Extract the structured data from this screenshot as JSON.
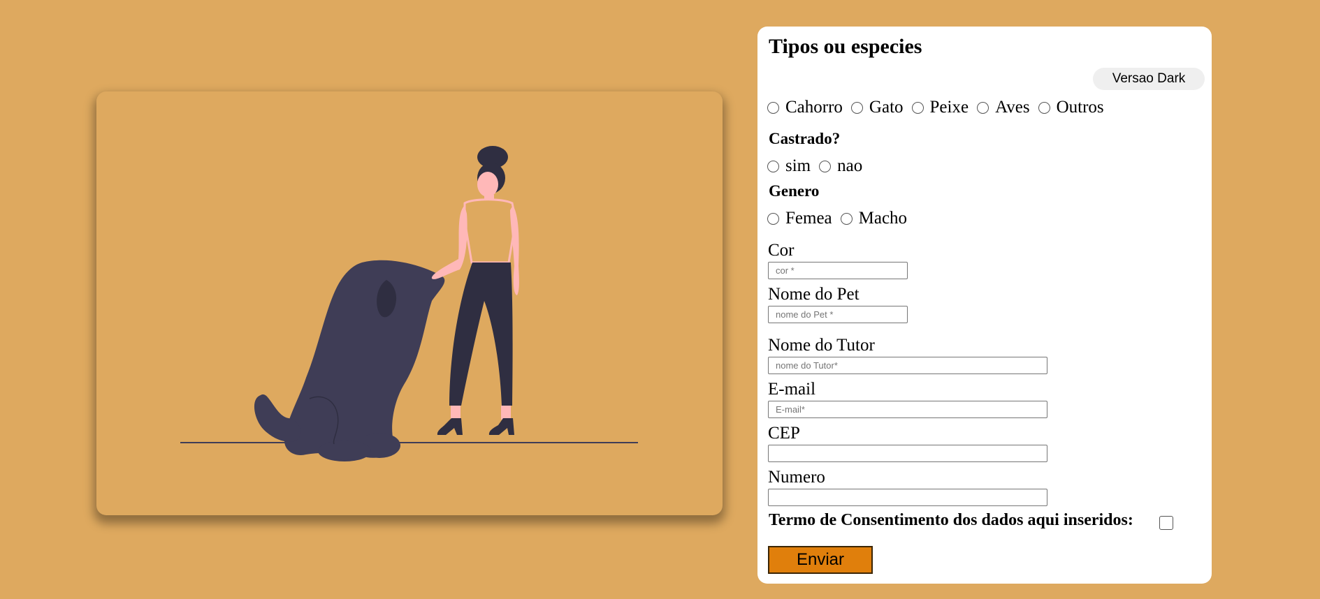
{
  "illustration": {
    "icon": "woman-with-dog-illustration",
    "colors": {
      "dark": "#3f3d56",
      "pants": "#2f2e41",
      "skin": "#ffb8b8",
      "card": "#dea95f"
    }
  },
  "form": {
    "title": "Tipos ou especies",
    "dark_mode_button": "Versao Dark",
    "species": [
      "Cahorro",
      "Gato",
      "Peixe",
      "Aves",
      "Outros"
    ],
    "neutered": {
      "label": "Castrado?",
      "options": [
        "sim",
        "nao"
      ]
    },
    "gender": {
      "label": "Genero",
      "options": [
        "Femea",
        "Macho"
      ]
    },
    "fields": {
      "color": {
        "label": "Cor",
        "placeholder": "cor *",
        "value": ""
      },
      "pet_name": {
        "label": "Nome do Pet",
        "placeholder": "nome do Pet *",
        "value": ""
      },
      "tutor_name": {
        "label": "Nome do Tutor",
        "placeholder": "nome do Tutor*",
        "value": ""
      },
      "email": {
        "label": "E-mail",
        "placeholder": "E-mail*",
        "value": ""
      },
      "cep": {
        "label": "CEP",
        "placeholder": "",
        "value": ""
      },
      "number": {
        "label": "Numero",
        "placeholder": "",
        "value": ""
      }
    },
    "consent_label": "Termo de Consentimento dos dados aqui inseridos:",
    "submit_label": "Enviar",
    "colors": {
      "page_bg": "#dea95f",
      "submit_bg": "#e07f0c",
      "button_bg": "#efefef"
    }
  }
}
